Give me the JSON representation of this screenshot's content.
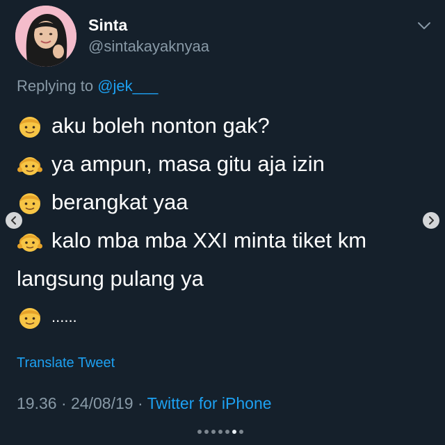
{
  "tweet": {
    "display_name": "Sinta",
    "handle": "@sintakayaknyaa",
    "replying_label": "Replying to",
    "replying_to": "@jek___",
    "lines": [
      {
        "emoji": "boy",
        "text": "aku boleh nonton gak?"
      },
      {
        "emoji": "girl",
        "text": "ya ampun, masa gitu aja izin"
      },
      {
        "emoji": "boy",
        "text": "berangkat yaa"
      },
      {
        "emoji": "girl",
        "text": "kalo mba mba XXI minta tiket km"
      },
      {
        "emoji": "",
        "text": "langsung pulang ya"
      },
      {
        "emoji": "boy",
        "text": "......"
      }
    ],
    "translate_label": "Translate Tweet",
    "time": "19.36",
    "date": "24/08/19",
    "source": "Twitter for iPhone"
  },
  "carousel": {
    "dot_count": 7,
    "active_index": 5
  },
  "colors": {
    "background": "#15202b",
    "accent": "#1da1f2",
    "secondary_text": "#8899a6"
  }
}
